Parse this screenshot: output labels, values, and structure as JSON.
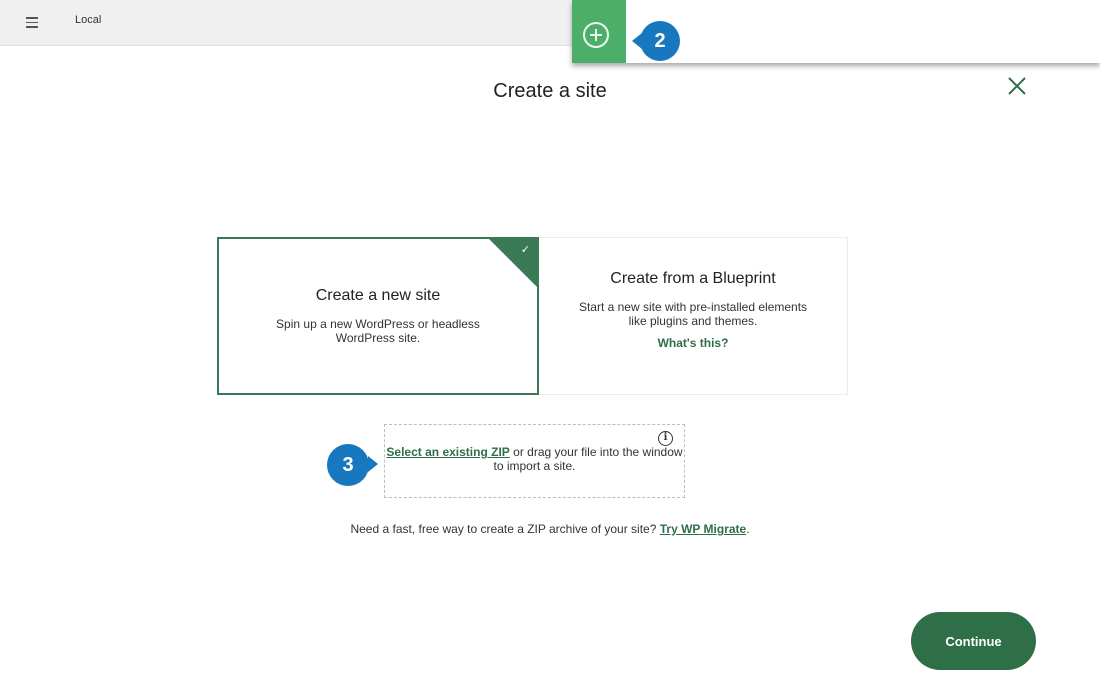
{
  "app": {
    "title": "Local"
  },
  "callouts": {
    "badge_2": "2",
    "badge_3": "3"
  },
  "dialog": {
    "title": "Create a site",
    "options": [
      {
        "title": "Create a new site",
        "description": "Spin up a new WordPress or headless WordPress site.",
        "selected": true
      },
      {
        "title": "Create from a Blueprint",
        "description": "Start a new site with pre-installed elements like plugins and themes.",
        "link": "What's this?",
        "selected": false
      }
    ],
    "import": {
      "link": "Select an existing ZIP",
      "text": "or drag your file into the window to import a site."
    },
    "migrate": {
      "text": "Need a fast, free way to create a ZIP archive of your site?",
      "link": "Try WP Migrate"
    },
    "continue_label": "Continue"
  },
  "icons": {
    "menu": "hamburger-icon",
    "add": "plus-icon",
    "close": "close-icon",
    "check": "check-icon",
    "info": "info-icon"
  },
  "colors": {
    "accent": "#2e6f48",
    "add_tile": "#4dae6a",
    "callout_badge": "#1778c0"
  }
}
